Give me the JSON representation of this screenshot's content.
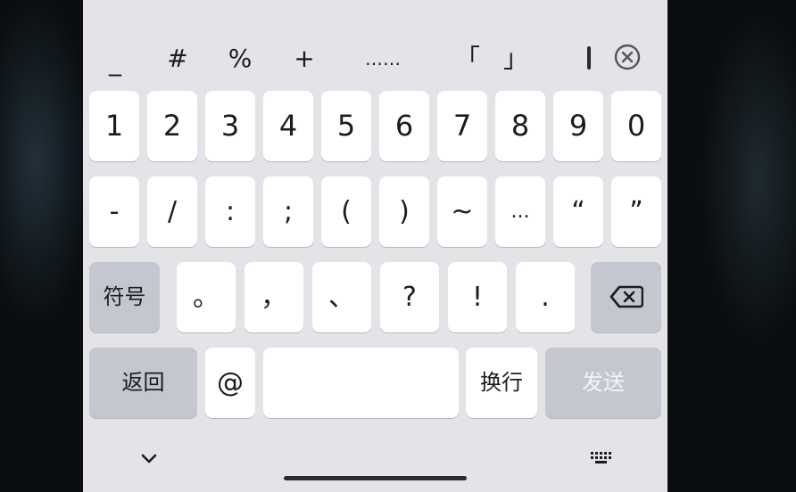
{
  "strip": {
    "symbols": [
      "_",
      "#",
      "%",
      "+",
      "……",
      "「",
      "」",
      "（"
    ],
    "clear_icon": "circle-x-icon"
  },
  "row1": [
    "1",
    "2",
    "3",
    "4",
    "5",
    "6",
    "7",
    "8",
    "9",
    "0"
  ],
  "row2": [
    "-",
    "/",
    ":",
    ";",
    "(",
    ")",
    "~",
    "...",
    "“",
    "”"
  ],
  "row3": {
    "symbols_label": "符号",
    "keys": [
      "。",
      "，",
      "、",
      "?",
      "!",
      "."
    ],
    "backspace_icon": "backspace-icon"
  },
  "row4": {
    "back_label": "返回",
    "at_label": "@",
    "newline_label": "换行",
    "send_label": "发送"
  },
  "bottom": {
    "collapse_icon": "chevron-down-icon",
    "keyboard_switch_icon": "keyboard-icon"
  },
  "colors": {
    "keyboard_bg": "#e3e3e8",
    "key_bg": "#ffffff",
    "function_key_bg": "#c4c7d0",
    "send_text": "#f5f5f7"
  }
}
